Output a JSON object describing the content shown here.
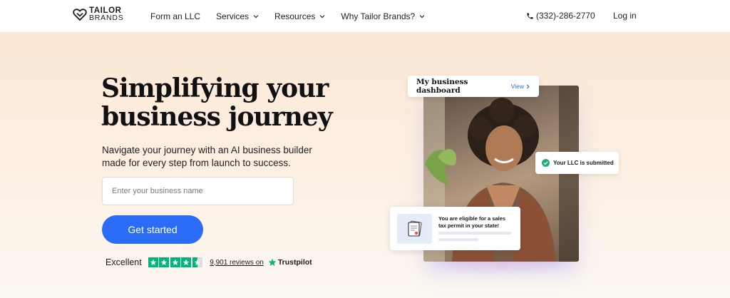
{
  "header": {
    "logo": {
      "line1": "TAILOR",
      "line2": "BRANDS"
    },
    "nav": [
      {
        "label": "Form an LLC"
      },
      {
        "label": "Services"
      },
      {
        "label": "Resources"
      },
      {
        "label": "Why Tailor Brands?"
      }
    ],
    "phone": "(332)-286-2770",
    "login": "Log in"
  },
  "hero": {
    "headline_line1": "Simplifying your",
    "headline_line2": "business journey",
    "subtext_line1": "Navigate your journey with an AI business builder",
    "subtext_line2": "made for every step from launch to success.",
    "input_placeholder": "Enter your business name",
    "input_value": "",
    "cta_label": "Get started",
    "rating": {
      "label": "Excellent",
      "stars": 4.5,
      "reviews": "9,901 reviews on",
      "provider": "Trustpilot"
    }
  },
  "visual": {
    "dashboard_title": "My business dashboard",
    "dashboard_link": "View",
    "llc_status": "Your LLC is submitted",
    "tax_line1": "You are eligible for a sales",
    "tax_line2": "tax permit in your state!"
  },
  "colors": {
    "accent": "#2a6cf6",
    "trustpilot_green": "#00b67a",
    "success_green": "#1db07a"
  }
}
